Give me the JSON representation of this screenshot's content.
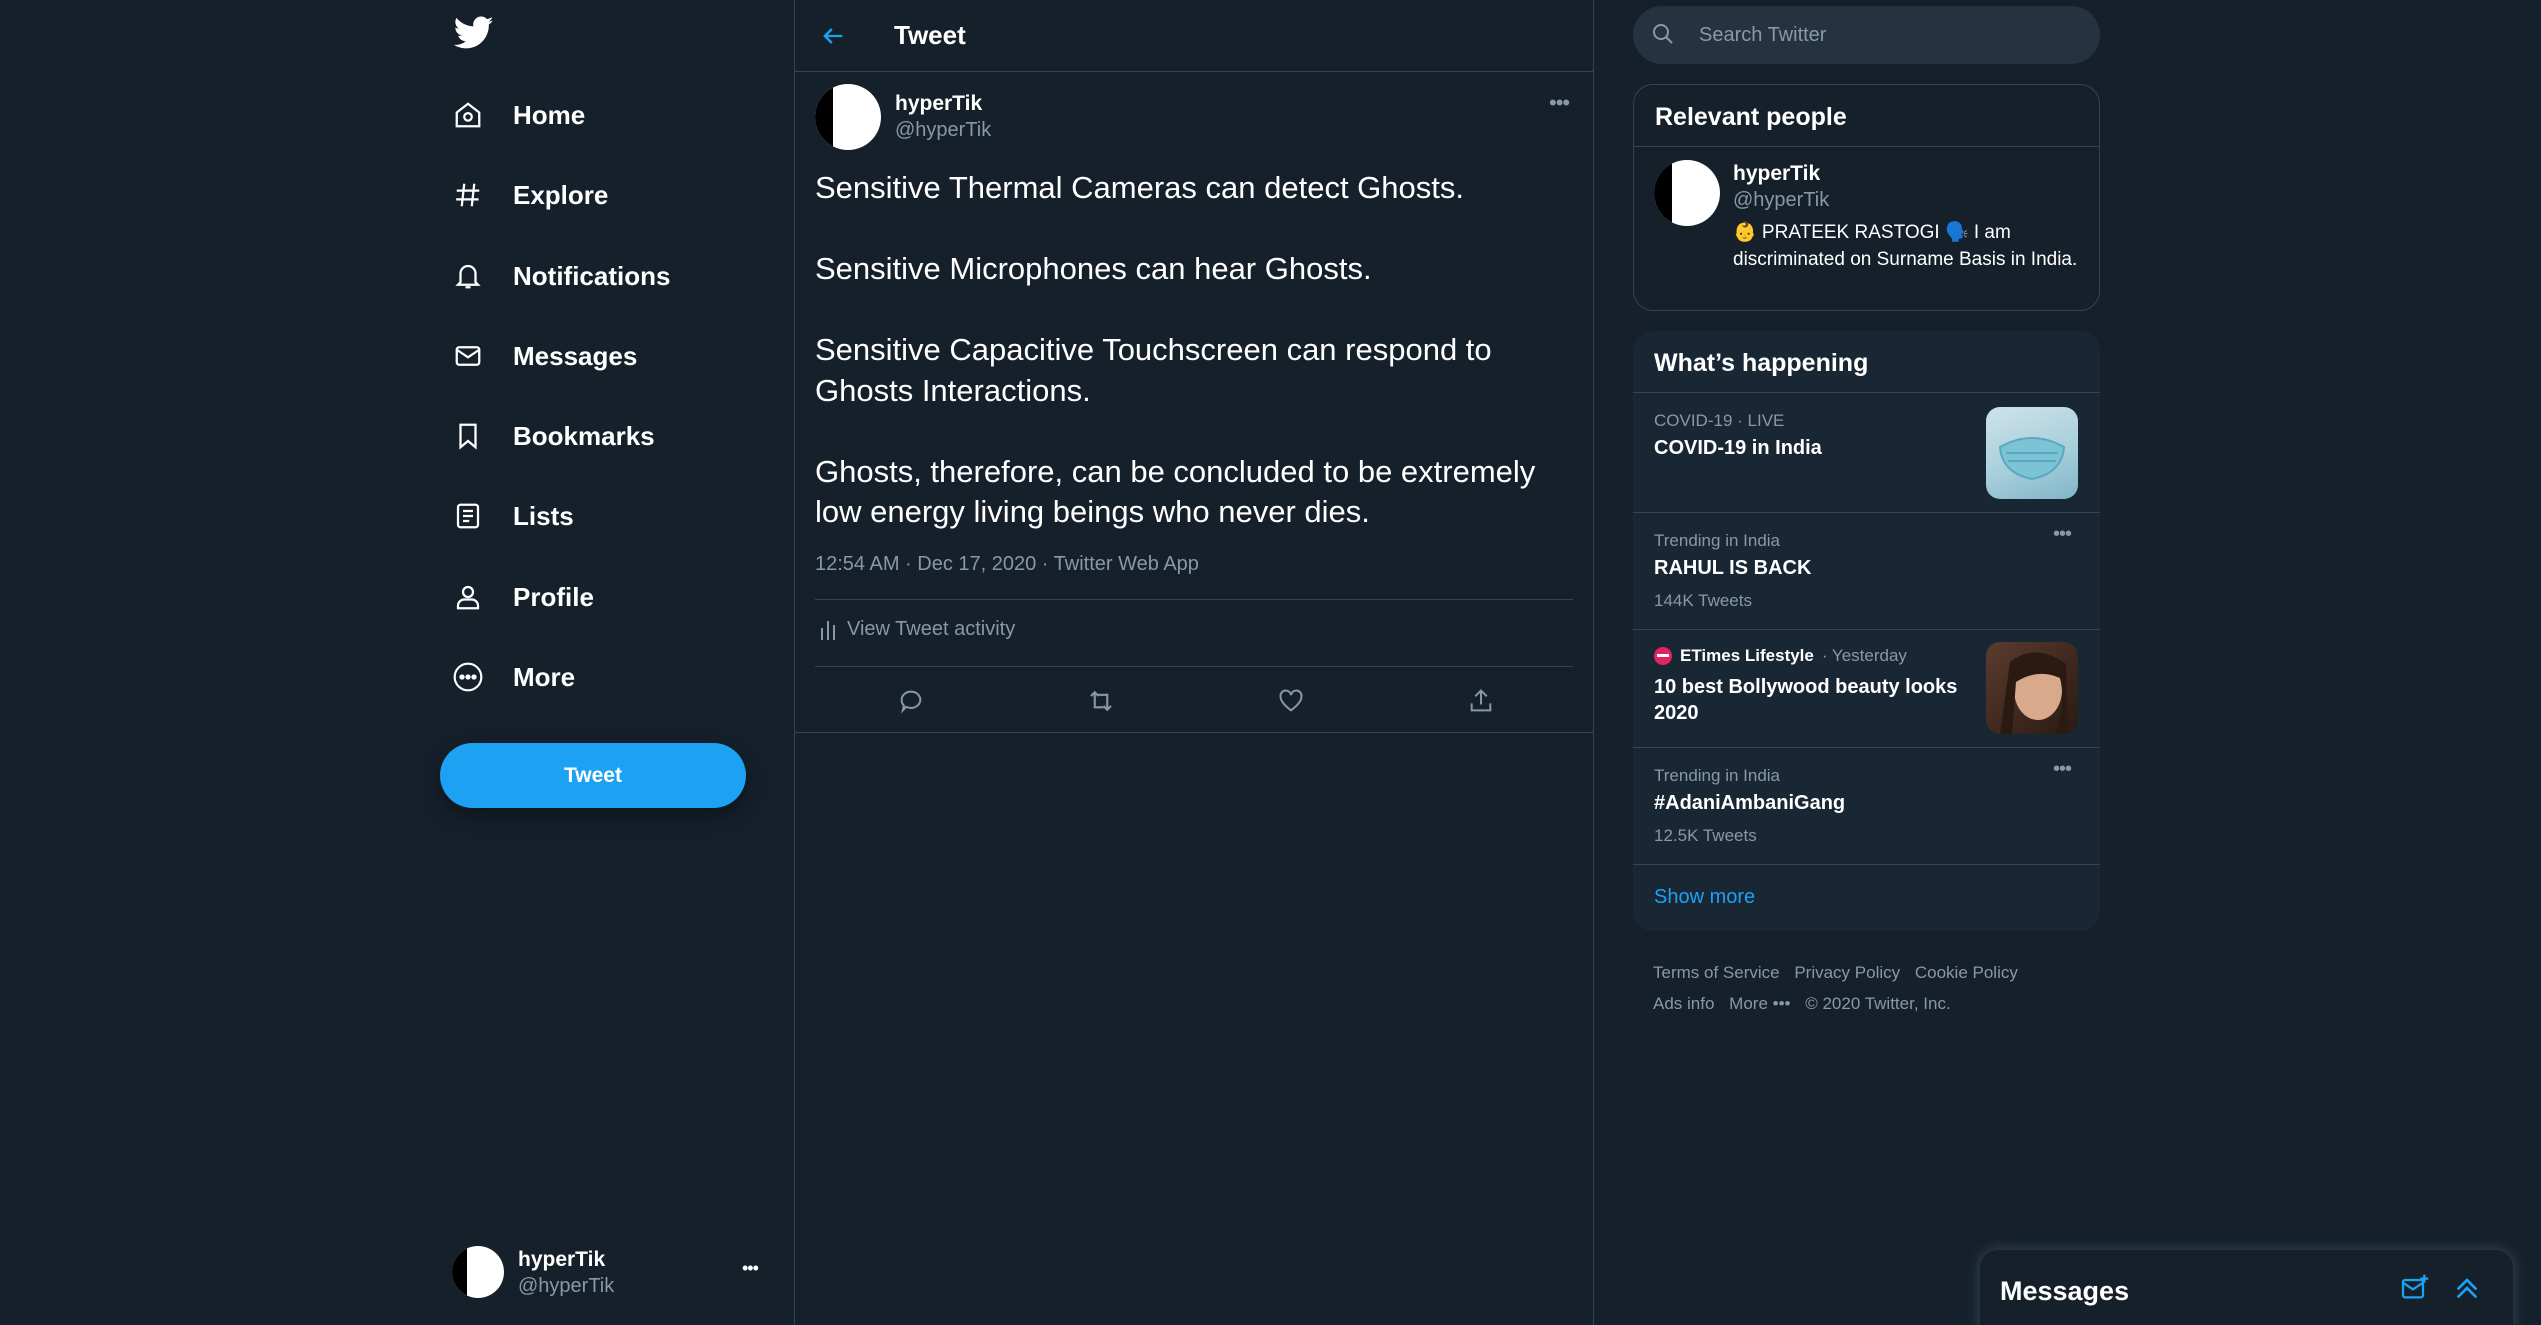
{
  "nav": {
    "items": [
      {
        "label": "Home",
        "icon": "home-icon"
      },
      {
        "label": "Explore",
        "icon": "hashtag-icon"
      },
      {
        "label": "Notifications",
        "icon": "bell-icon"
      },
      {
        "label": "Messages",
        "icon": "envelope-icon"
      },
      {
        "label": "Bookmarks",
        "icon": "bookmark-icon"
      },
      {
        "label": "Lists",
        "icon": "list-icon"
      },
      {
        "label": "Profile",
        "icon": "person-icon"
      },
      {
        "label": "More",
        "icon": "more-circle-icon"
      }
    ],
    "tweet_button": "Tweet"
  },
  "account": {
    "name": "hyperTik",
    "handle": "@hyperTik",
    "more": "•••"
  },
  "header": {
    "title": "Tweet"
  },
  "tweet": {
    "author_name": "hyperTik",
    "author_handle": "@hyperTik",
    "more": "•••",
    "paragraphs": [
      "Sensitive Thermal Cameras can detect Ghosts.",
      "Sensitive Microphones can hear Ghosts.",
      "Sensitive Capacitive Touchscreen can respond to Ghosts Interactions.",
      "Ghosts, therefore, can be concluded to be extremely low energy living beings who never dies."
    ],
    "meta": "12:54 AM · Dec 17, 2020 · Twitter Web App",
    "activity_label": "View Tweet activity"
  },
  "search": {
    "placeholder": "Search Twitter"
  },
  "relevant": {
    "title": "Relevant people",
    "name": "hyperTik",
    "handle": "@hyperTik",
    "bio": "👶 PRATEEK RASTOGI 🗣️ I am discriminated on Surname Basis in India."
  },
  "happening": {
    "title": "What’s happening",
    "trends": [
      {
        "category": "COVID-19 · LIVE",
        "title": "COVID-19 in India",
        "count": ""
      },
      {
        "category": "Trending in India",
        "title": "RAHUL IS BACK",
        "count": "144K Tweets"
      },
      {
        "source": "ETimes Lifestyle",
        "time": "· Yesterday",
        "title": "10 best Bollywood beauty looks 2020"
      },
      {
        "category": "Trending in India",
        "title": "#AdaniAmbaniGang",
        "count": "12.5K Tweets"
      }
    ],
    "more_dots": "•••",
    "show_more": "Show more"
  },
  "footer": {
    "terms": "Terms of Service",
    "privacy": "Privacy Policy",
    "cookie": "Cookie Policy",
    "ads": "Ads info",
    "more": "More •••",
    "copyright": "© 2020 Twitter, Inc."
  },
  "messages_drawer": {
    "title": "Messages"
  },
  "colors": {
    "accent": "#1da1f2",
    "background": "#15202b",
    "card": "#192734",
    "muted": "#8899a6",
    "border": "#38444d"
  }
}
